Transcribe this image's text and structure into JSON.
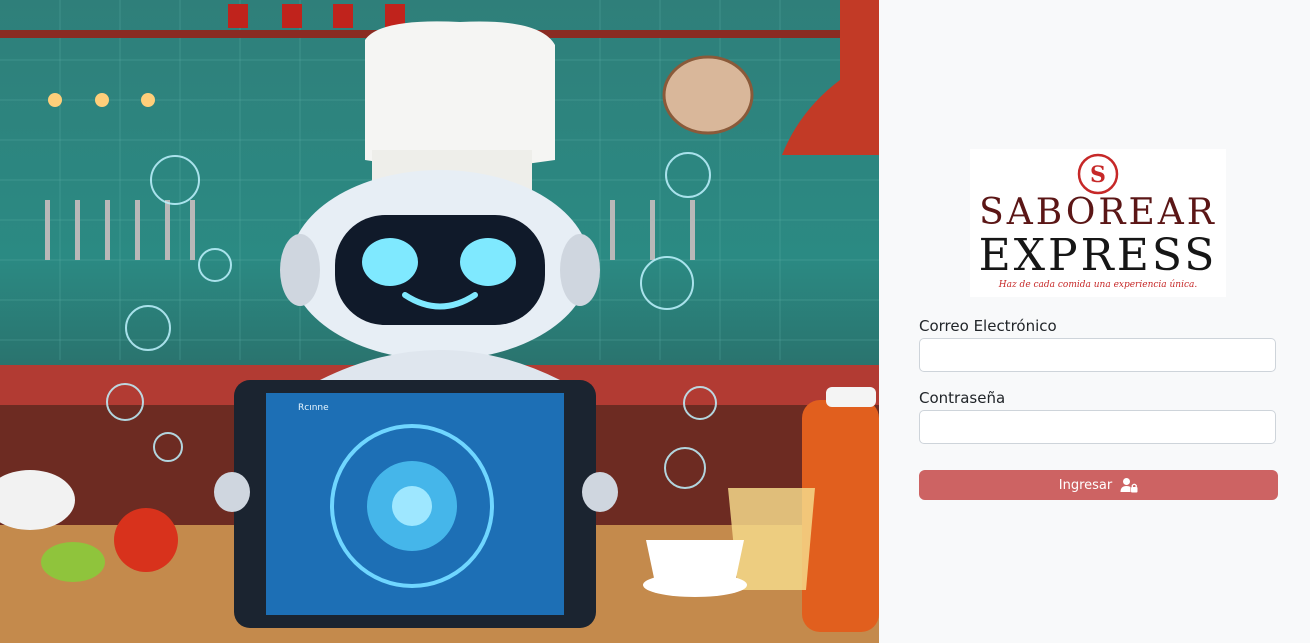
{
  "hero": {
    "image_description_icon": "chef-robot-illustration",
    "tablet_text": "Rcınne"
  },
  "logo": {
    "line1": "SABOREAR",
    "line2": "EXPRESS",
    "tagline": "Haz de cada comida una experiencia única.",
    "emblem_letter": "S"
  },
  "form": {
    "email_label": "Correo Electrónico",
    "email_value": "",
    "password_label": "Contraseña",
    "password_value": "",
    "submit_label": "Ingresar",
    "submit_icon": "user-lock-icon"
  },
  "colors": {
    "accent": "#cd6363",
    "panel_bg": "#f8f9fa"
  }
}
